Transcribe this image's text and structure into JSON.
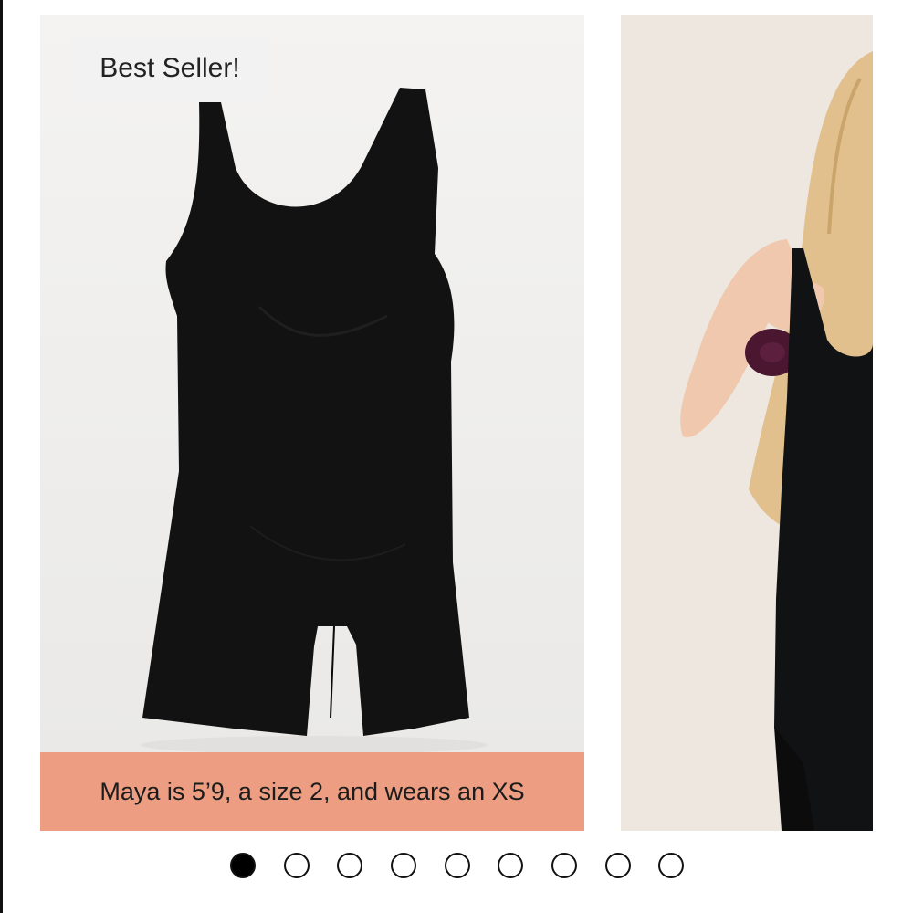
{
  "gallery": {
    "badge": "Best Seller!",
    "caption": "Maya is 5’9, a size 2, and wears an XS",
    "slide_count": 9,
    "active_slide": 1,
    "colors": {
      "badge_bg": "#f2f2f2",
      "caption_bg": "#ed9e82",
      "product_bg": "#f1f0ee",
      "garment": "#121212",
      "dot_active": "#000000"
    }
  }
}
